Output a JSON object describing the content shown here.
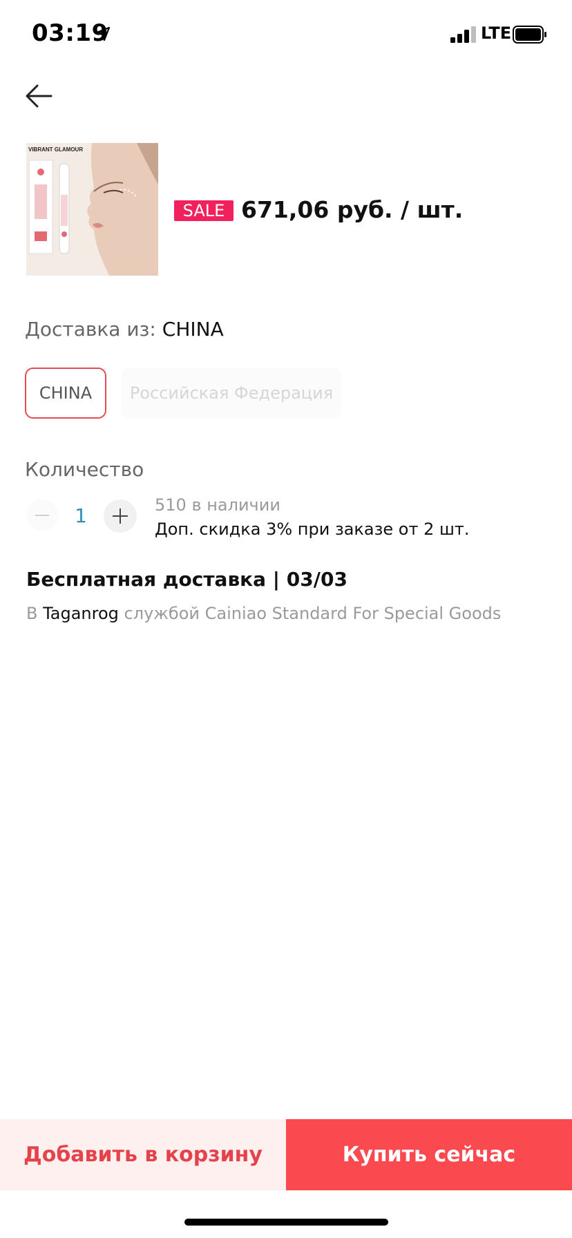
{
  "status_bar": {
    "time": "03:19",
    "network": "LTE"
  },
  "product": {
    "image_brand": "VIBRANT GLAMOUR",
    "sale_badge": "SALE",
    "price": "671,06 руб. / шт."
  },
  "shipping": {
    "from_label": "Доставка из: ",
    "from_value": "CHINA",
    "options": [
      "CHINA",
      "Российская Федерация"
    ],
    "selected": "CHINA"
  },
  "quantity": {
    "label": "Количество",
    "value": "1",
    "stock": "510 в наличии",
    "discount": "Доп. скидка 3% при заказе от 2 шт."
  },
  "delivery": {
    "title": "Бесплатная доставка | 03/03",
    "prefix": "В ",
    "city": "Taganrog",
    "suffix": " службой Cainiao Standard For Special Goods"
  },
  "actions": {
    "add_to_cart": "Добавить в корзину",
    "buy_now": "Купить сейчас"
  },
  "colors": {
    "accent": "#fb4a4f",
    "sale": "#f0215c",
    "selected_border": "#e34b52"
  }
}
